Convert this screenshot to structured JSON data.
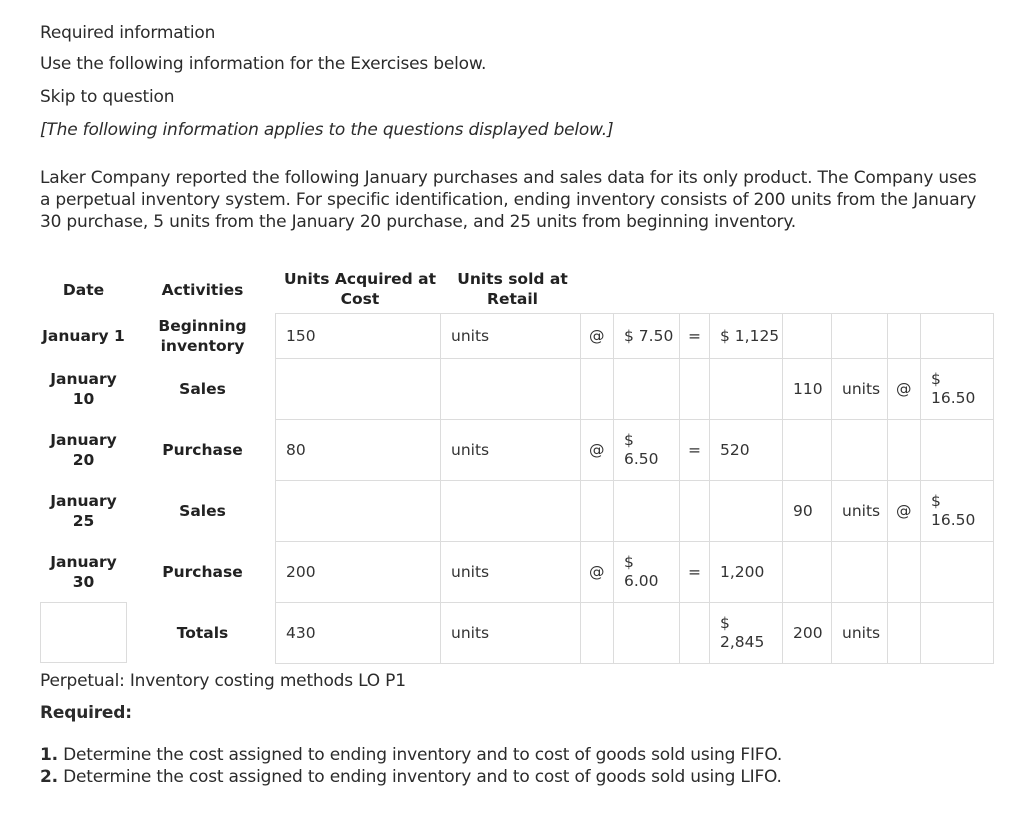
{
  "header": {
    "required_information": "Required information",
    "use_following": "Use the following information for the Exercises below.",
    "skip_to_question": "Skip to question",
    "applies_note": "[The following information applies to the questions displayed below.]"
  },
  "intro": "Laker Company reported the following January purchases and sales data for its only product. The Company uses a perpetual inventory system. For specific identification, ending inventory consists of 200 units from the January 30 purchase, 5 units from the January 20 purchase, and 25 units from beginning inventory.",
  "table": {
    "headers": {
      "date": "Date",
      "activities": "Activities",
      "units_acquired": "Units Acquired at Cost",
      "units_sold": "Units sold at Retail"
    },
    "rows": [
      {
        "date": "January 1",
        "activity": "Beginning inventory",
        "acq_units": "150",
        "acq_label": "units",
        "at": "@",
        "unit_cost": "$ 7.50",
        "eq": "=",
        "cost_total": "$ 1,125",
        "sold_units": "",
        "sold_label": "",
        "sold_at": "",
        "retail_price": ""
      },
      {
        "date": "January 10",
        "activity": "Sales",
        "acq_units": "",
        "acq_label": "",
        "at": "",
        "unit_cost": "",
        "eq": "",
        "cost_total": "",
        "sold_units": "110",
        "sold_label": "units",
        "sold_at": "@",
        "retail_price": "$ 16.50"
      },
      {
        "date": "January 20",
        "activity": "Purchase",
        "acq_units": "80",
        "acq_label": "units",
        "at": "@",
        "unit_cost": "$ 6.50",
        "eq": "=",
        "cost_total": "520",
        "sold_units": "",
        "sold_label": "",
        "sold_at": "",
        "retail_price": ""
      },
      {
        "date": "January 25",
        "activity": "Sales",
        "acq_units": "",
        "acq_label": "",
        "at": "",
        "unit_cost": "",
        "eq": "",
        "cost_total": "",
        "sold_units": "90",
        "sold_label": "units",
        "sold_at": "@",
        "retail_price": "$ 16.50"
      },
      {
        "date": "January 30",
        "activity": "Purchase",
        "acq_units": "200",
        "acq_label": "units",
        "at": "@",
        "unit_cost": "$ 6.00",
        "eq": "=",
        "cost_total": "1,200",
        "sold_units": "",
        "sold_label": "",
        "sold_at": "",
        "retail_price": ""
      },
      {
        "date": "",
        "activity": "Totals",
        "acq_units": "430",
        "acq_label": "units",
        "at": "",
        "unit_cost": "",
        "eq": "",
        "cost_total": "$ 2,845",
        "sold_units": "200",
        "sold_label": "units",
        "sold_at": "",
        "retail_price": ""
      }
    ]
  },
  "footer": {
    "topic": "Perpetual: Inventory costing methods LO P1",
    "required_label": "Required:",
    "items": [
      {
        "num": "1.",
        "text": " Determine the cost assigned to ending inventory and to cost of goods sold using FIFO."
      },
      {
        "num": "2.",
        "text": " Determine the cost assigned to ending inventory and to cost of goods sold using LIFO."
      }
    ]
  }
}
